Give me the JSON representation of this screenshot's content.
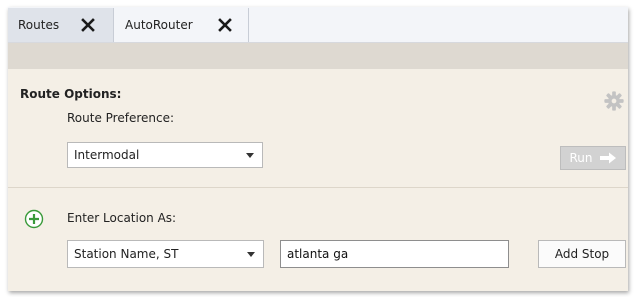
{
  "tabs": [
    {
      "label": "Routes",
      "close_icon": "close-icon"
    },
    {
      "label": "AutoRouter",
      "close_icon": "close-icon",
      "active": true
    }
  ],
  "route_options": {
    "title": "Route Options:",
    "settings_icon": "gear-icon",
    "preference_label": "Route Preference:",
    "preference_value": "Intermodal",
    "run_label": "Run",
    "run_icon": "arrow-right-icon"
  },
  "location": {
    "add_icon": "plus-circle-icon",
    "enter_as_label": "Enter Location As:",
    "format_value": "Station Name, ST",
    "input_value": "atlanta ga",
    "add_stop_label": "Add Stop"
  },
  "colors": {
    "panel_bg": "#f4efe6",
    "tab_active_bg": "#f3f5f9",
    "tab_inactive_bg": "#dfe3ea",
    "header_bar": "#ded9d1",
    "accent_green": "#3a9a3a",
    "run_disabled": "#d2d2d2"
  }
}
